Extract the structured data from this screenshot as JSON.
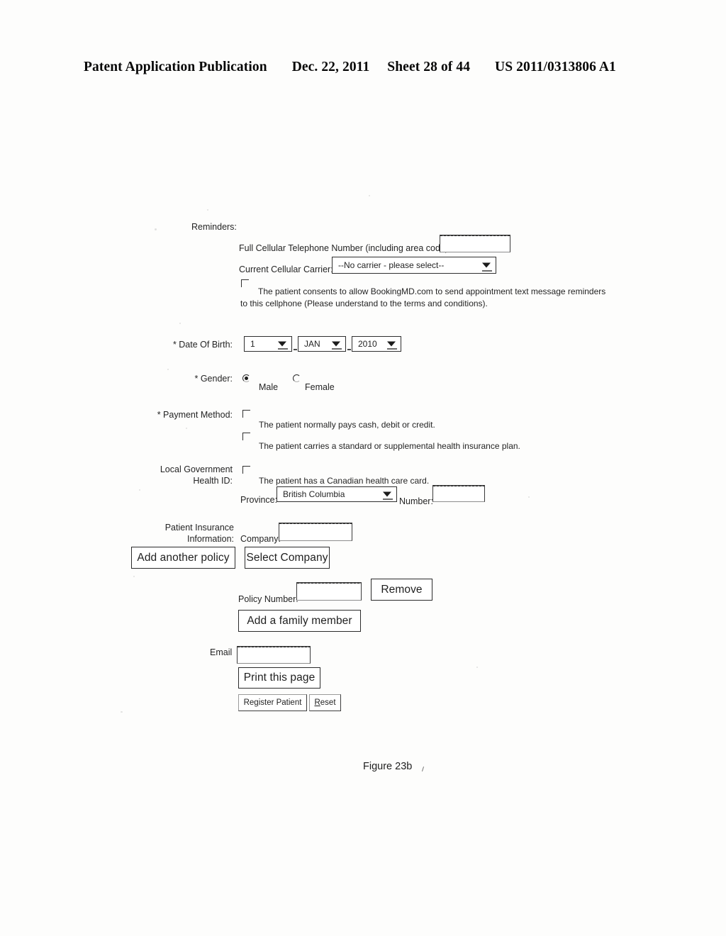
{
  "header": {
    "publication": "Patent Application Publication",
    "date": "Dec. 22, 2011",
    "sheet": "Sheet 28 of 44",
    "number": "US 2011/0313806 A1"
  },
  "figure": {
    "caption": "Figure 23b"
  },
  "form": {
    "reminders": {
      "label": "Reminders:",
      "cell_phone_label": "Full Cellular Telephone Number (including area code):",
      "cell_phone_value": "",
      "carrier_label": "Current Cellular Carrier:",
      "carrier_value": "--No carrier - please select--",
      "consent_line1": "The patient consents to allow BookingMD.com to send appointment text message reminders to",
      "consent_line2": "this cellphone (Please understand to the terms and conditions).",
      "consent_checked": false
    },
    "date_of_birth": {
      "label": "* Date Of Birth:",
      "day": "1",
      "month": "JAN",
      "year": "2010"
    },
    "gender": {
      "label": "* Gender:",
      "male_label": "Male",
      "female_label": "Female",
      "selected": "Male"
    },
    "payment_method": {
      "label": "* Payment Method:",
      "option1": "The patient normally pays cash, debit or credit.",
      "option1_checked": false,
      "option2": "The patient carries a standard or supplemental health insurance plan.",
      "option2_checked": false
    },
    "local_gov_health_id": {
      "label_line1": "Local Government",
      "label_line2": "Health ID:",
      "card_option": "The patient has a Canadian health care card.",
      "card_checked": false,
      "province_label": "Province:",
      "province_value": "British Columbia",
      "number_label": "Number:",
      "number_value": ""
    },
    "patient_insurance": {
      "label_line1": "Patient Insurance",
      "label_line2": "Information:",
      "company_label": "Company:",
      "company_value": "",
      "add_policy_button": "Add another policy",
      "select_company_button": "Select Company",
      "policy_number_label": "Policy Number:",
      "policy_number_value": "",
      "remove_button": "Remove",
      "add_family_member_button": "Add a family member"
    },
    "email": {
      "label": "Email",
      "value": ""
    },
    "actions": {
      "print_button": "Print this page",
      "register_button_pre": "Re",
      "register_button_accel": "g",
      "register_button_post": "ister Patient",
      "reset_button_accel": "R",
      "reset_button_post": "eset"
    }
  }
}
